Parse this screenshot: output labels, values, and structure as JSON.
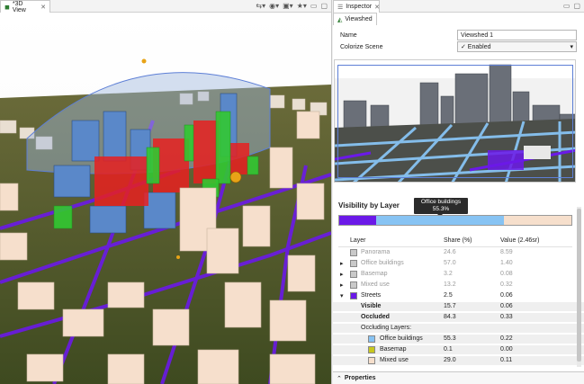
{
  "left_view": {
    "tab_title": "*3D View",
    "tab_close": "✕"
  },
  "inspector": {
    "tab_title": "Inspector",
    "tab_close": "✕",
    "subtab_title": "Viewshed",
    "name_label": "Name",
    "name_value": "Viewshed 1",
    "colorize_label": "Colorize Scene",
    "colorize_value": "✓ Enabled",
    "section_title": "Visibility by Layer",
    "tooltip_title": "Office buildings",
    "tooltip_value": "55.3%",
    "visibility_bar": [
      {
        "layer": "Streets",
        "share_percent": 15.7,
        "color": "#6b19e8"
      },
      {
        "layer": "Office buildings",
        "share_percent": 55.3,
        "color": "#87c3f3"
      },
      {
        "layer": "Basemap",
        "share_percent": 0.1,
        "color": "#c8c81e"
      },
      {
        "layer": "Mixed use",
        "share_percent": 28.9,
        "color": "#f6dfcc"
      }
    ],
    "table_headers": {
      "layer": "Layer",
      "share": "Share (%)",
      "value": "Value (2.46sr)"
    },
    "rows": [
      {
        "name": "Panorama",
        "share": "24.6",
        "value": "8.59",
        "muted": true,
        "color": "#c9c9c9"
      },
      {
        "name": "Office buildings",
        "share": "57.0",
        "value": "1.40",
        "muted": true,
        "color": "#c9c9c9"
      },
      {
        "name": "Basemap",
        "share": "3.2",
        "value": "0.08",
        "muted": true,
        "color": "#c9c9c9"
      },
      {
        "name": "Mixed use",
        "share": "13.2",
        "value": "0.32",
        "muted": true,
        "color": "#c9c9c9"
      },
      {
        "name": "Streets",
        "share": "2.5",
        "value": "0.06",
        "muted": false,
        "color": "#6b19e8"
      }
    ],
    "detail": {
      "visible_label": "Visible",
      "visible_share": "15.7",
      "visible_value": "0.06",
      "occluded_label": "Occluded",
      "occluded_share": "84.3",
      "occluded_value": "0.33",
      "occluding_label": "Occluding Layers:",
      "occluding": [
        {
          "name": "Office buildings",
          "share": "55.3",
          "value": "0.22",
          "color": "#87c3f3"
        },
        {
          "name": "Basemap",
          "share": "0.1",
          "value": "0.00",
          "color": "#c8c81e"
        },
        {
          "name": "Mixed use",
          "share": "29.0",
          "value": "0.11",
          "color": "#f6dfcc"
        }
      ]
    },
    "properties_label": "Properties"
  },
  "colors": {
    "streets": "#6b19e8",
    "office": "#87c3f3",
    "mixed_use": "#f6dfcc",
    "visible": "#32c832",
    "hidden": "#e82020",
    "selection": "#5d7fd6"
  },
  "icons": [
    "view-icon",
    "camera-icon",
    "screenshot-icon",
    "bookmark-icon",
    "maximize-icon",
    "minimize-icon",
    "inspector-icon",
    "viewshed-icon",
    "expand-icon",
    "collapse-icon"
  ]
}
